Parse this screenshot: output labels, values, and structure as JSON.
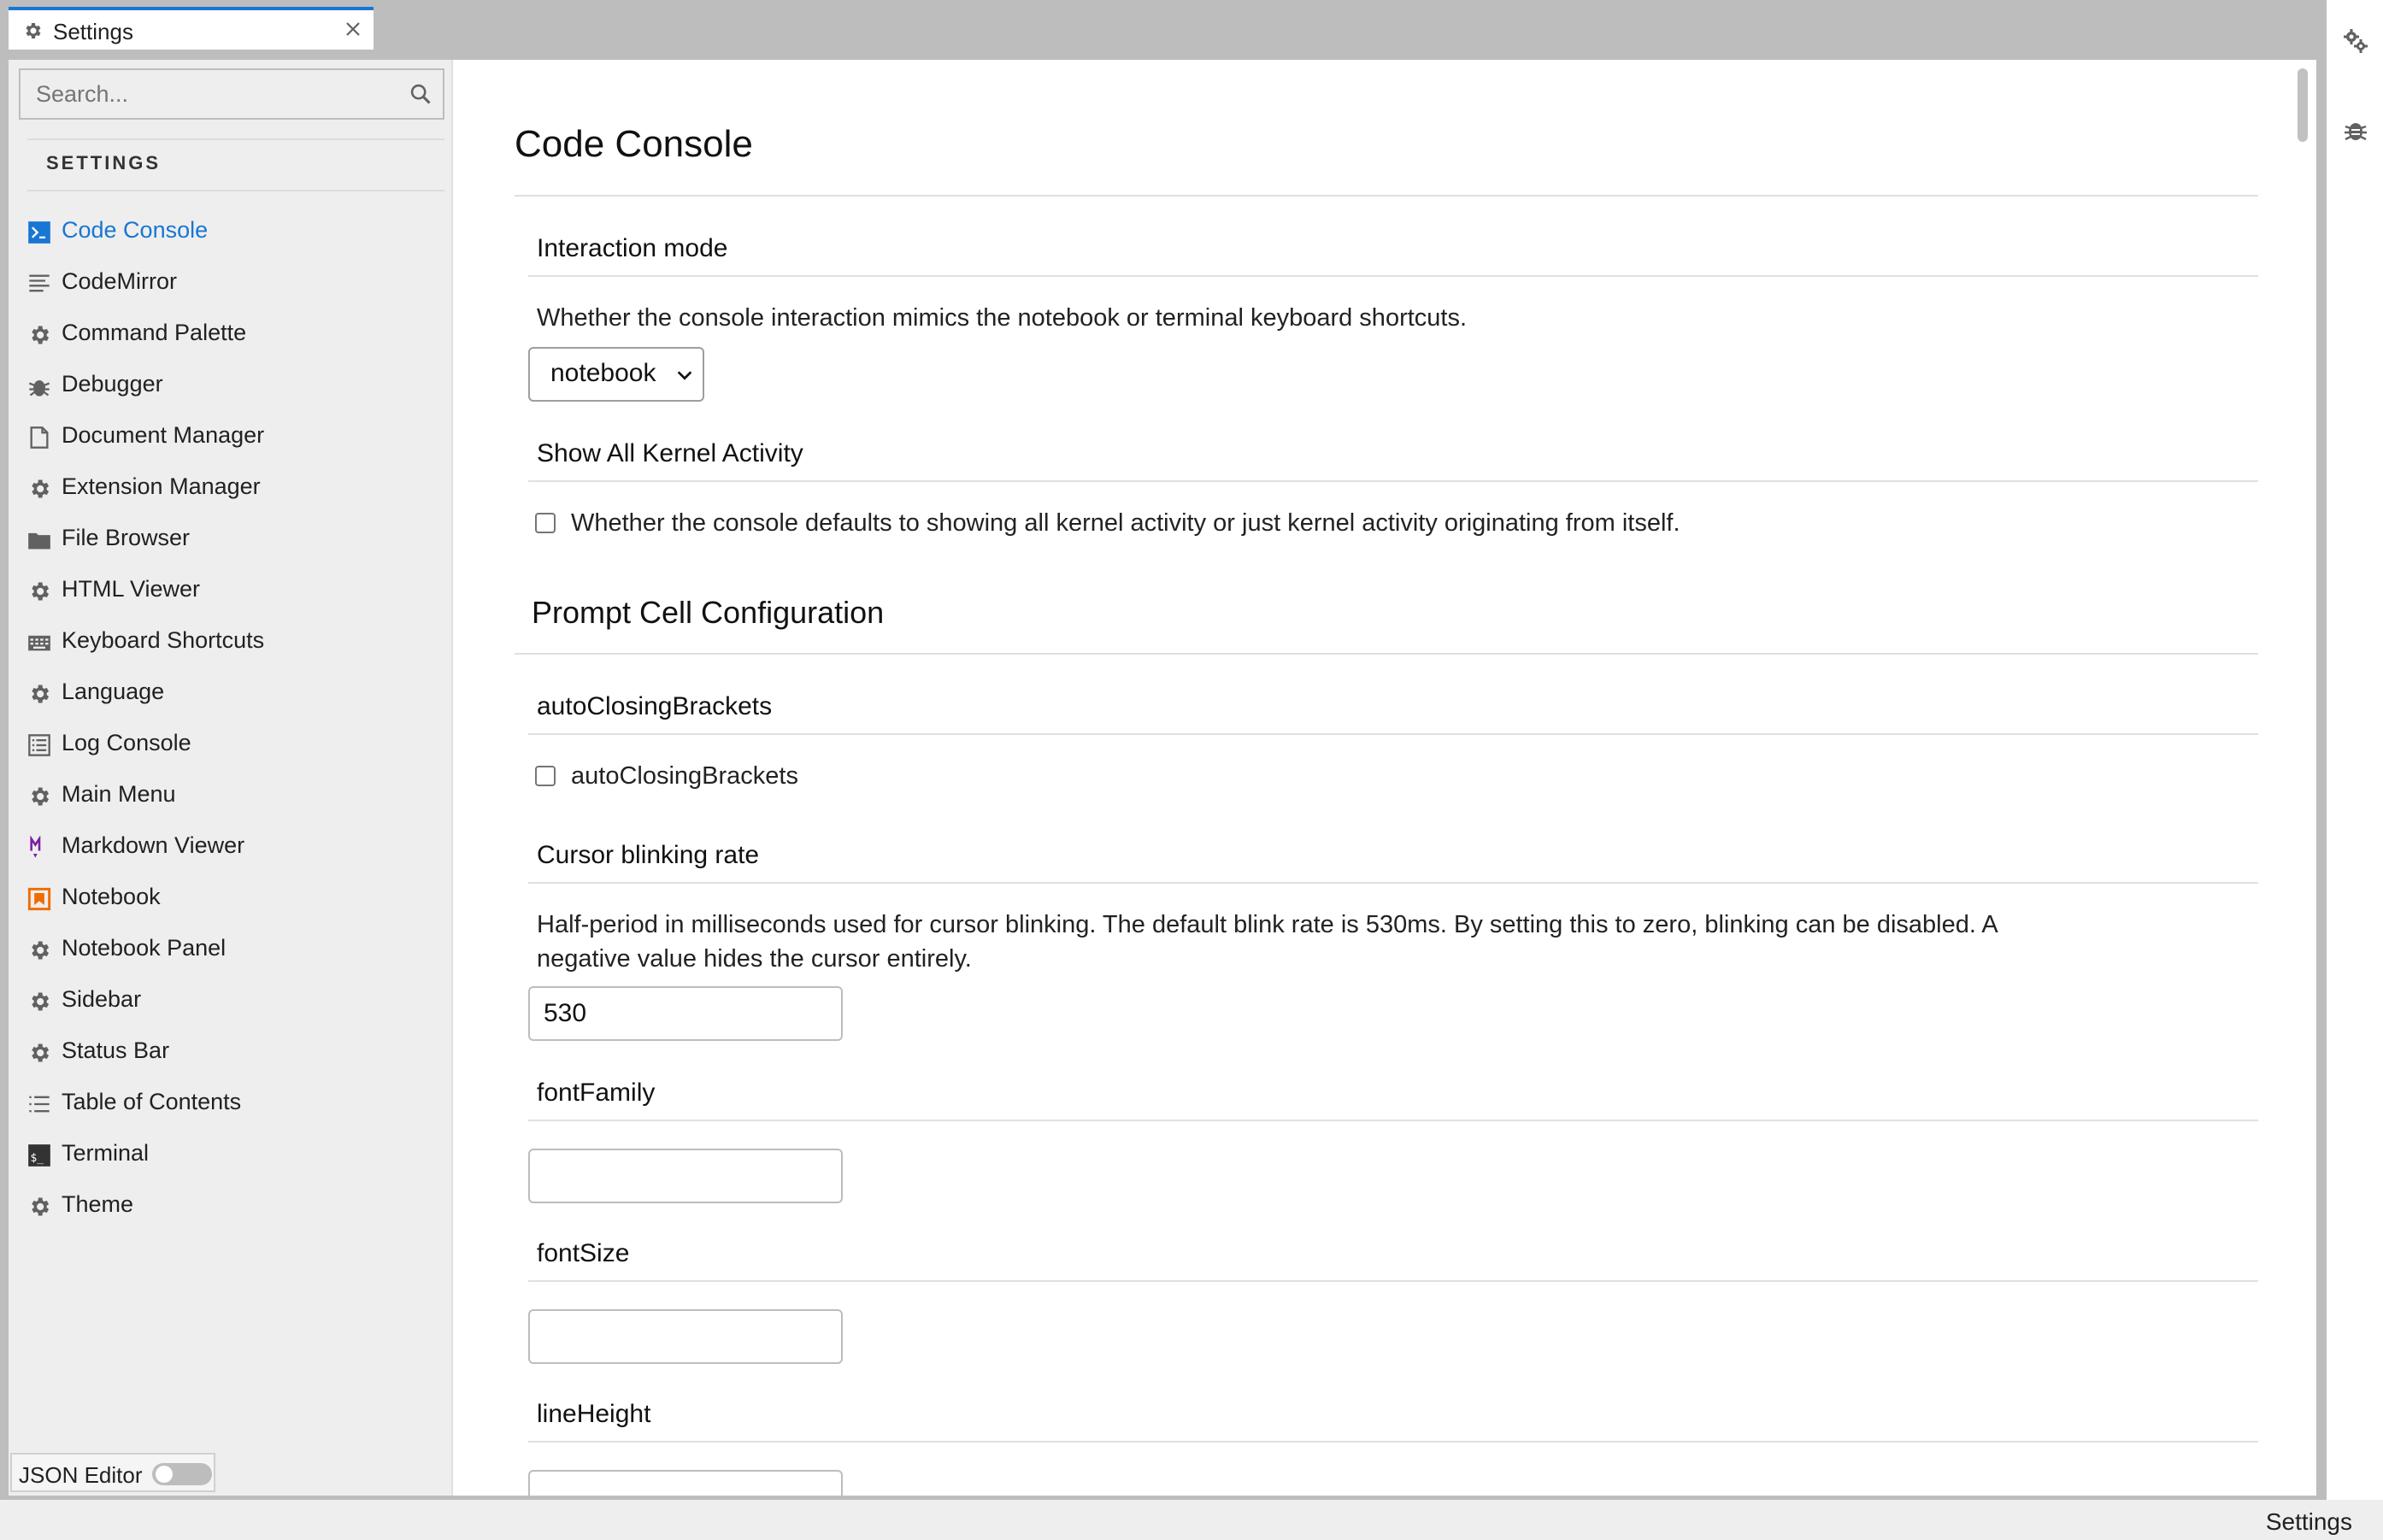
{
  "tab": {
    "label": "Settings",
    "icon": "gear-icon",
    "close_icon": "close-icon"
  },
  "right_panel": {
    "icons": [
      "property-inspector-icon",
      "debugger-bug-icon"
    ]
  },
  "search": {
    "placeholder": "Search...",
    "value": ""
  },
  "sidebar": {
    "header": "SETTINGS",
    "active_color": "#1976d2",
    "items": [
      {
        "label": "Code Console",
        "icon": "console-icon",
        "active": true
      },
      {
        "label": "CodeMirror",
        "icon": "text-lines-icon"
      },
      {
        "label": "Command Palette",
        "icon": "gear-icon"
      },
      {
        "label": "Debugger",
        "icon": "bug-icon"
      },
      {
        "label": "Document Manager",
        "icon": "document-icon"
      },
      {
        "label": "Extension Manager",
        "icon": "gear-icon"
      },
      {
        "label": "File Browser",
        "icon": "folder-icon"
      },
      {
        "label": "HTML Viewer",
        "icon": "gear-icon"
      },
      {
        "label": "Keyboard Shortcuts",
        "icon": "keyboard-icon"
      },
      {
        "label": "Language",
        "icon": "gear-icon"
      },
      {
        "label": "Log Console",
        "icon": "list-icon"
      },
      {
        "label": "Main Menu",
        "icon": "gear-icon"
      },
      {
        "label": "Markdown Viewer",
        "icon": "markdown-icon"
      },
      {
        "label": "Notebook",
        "icon": "notebook-icon"
      },
      {
        "label": "Notebook Panel",
        "icon": "gear-icon"
      },
      {
        "label": "Sidebar",
        "icon": "gear-icon"
      },
      {
        "label": "Status Bar",
        "icon": "gear-icon"
      },
      {
        "label": "Table of Contents",
        "icon": "toc-icon"
      },
      {
        "label": "Terminal",
        "icon": "terminal-icon"
      },
      {
        "label": "Theme",
        "icon": "gear-icon"
      }
    ],
    "json_editor_label": "JSON Editor",
    "json_editor_on": false
  },
  "content": {
    "title": "Code Console",
    "interaction_mode": {
      "title": "Interaction mode",
      "description": "Whether the console interaction mimics the notebook or terminal keyboard shortcuts.",
      "selected": "notebook"
    },
    "show_all_kernel_activity": {
      "title": "Show All Kernel Activity",
      "checkbox_label": "Whether the console defaults to showing all kernel activity or just kernel activity originating from itself.",
      "checked": false
    },
    "prompt_cell_section": "Prompt Cell Configuration",
    "auto_closing_brackets": {
      "title": "autoClosingBrackets",
      "checkbox_label": "autoClosingBrackets",
      "checked": false
    },
    "cursor_blink_rate": {
      "title": "Cursor blinking rate",
      "description_line1": "Half-period in milliseconds used for cursor blinking. The default blink rate is 530ms. By setting this to zero, blinking can be disabled. A",
      "description_line2": "negative value hides the cursor entirely.",
      "value": "530"
    },
    "font_family": {
      "title": "fontFamily",
      "value": ""
    },
    "font_size": {
      "title": "fontSize",
      "value": ""
    },
    "line_height": {
      "title": "lineHeight",
      "value": ""
    }
  },
  "status_bar": {
    "label": "Settings"
  }
}
